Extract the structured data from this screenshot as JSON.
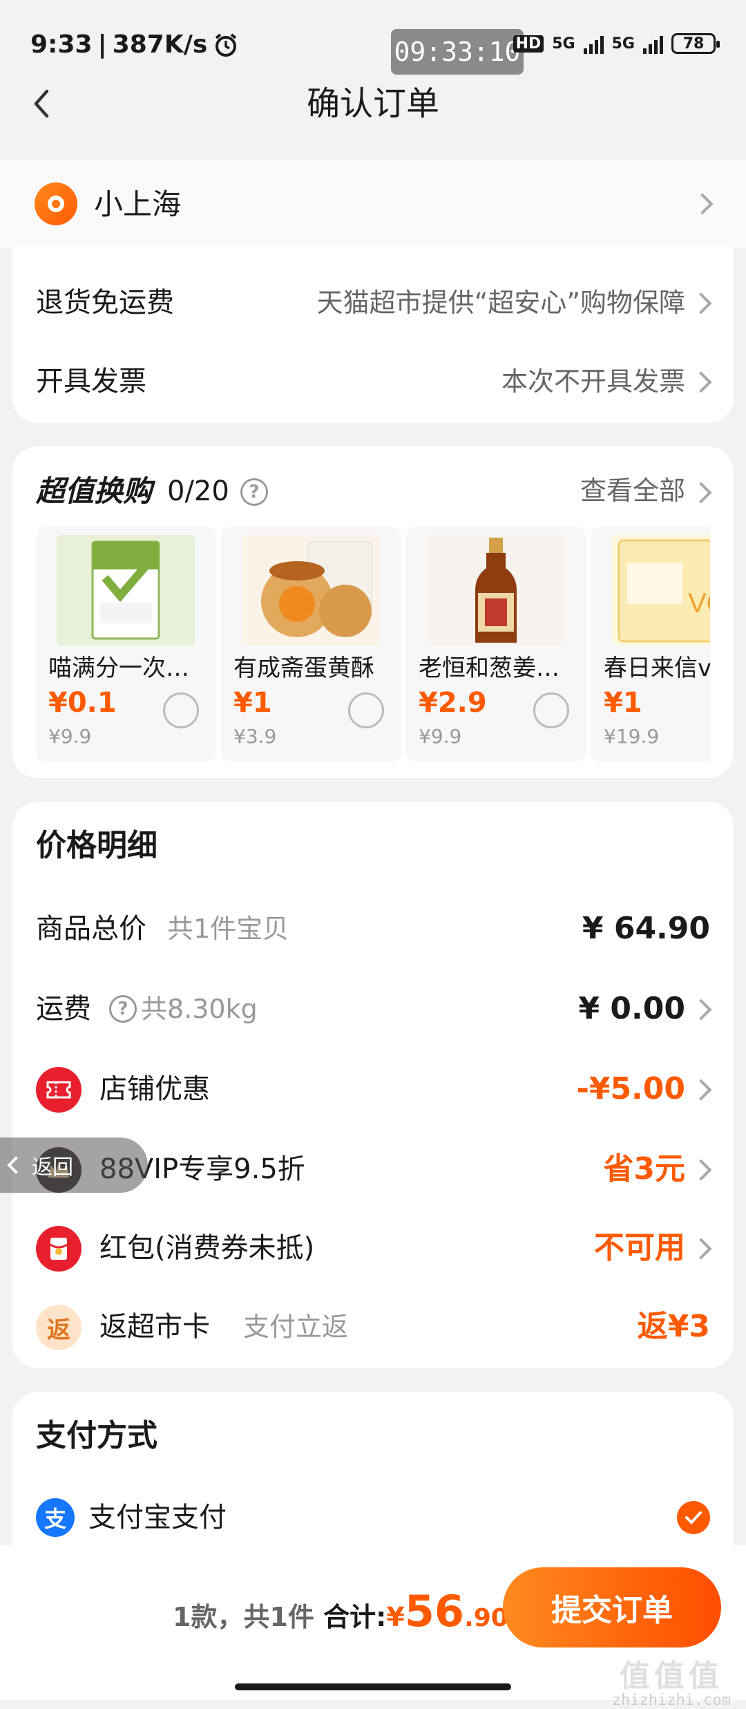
{
  "status_bar": {
    "time": "9:33",
    "speed": "387K/s",
    "clock_box": "09:33:10",
    "hd": "HD",
    "net1": "5G",
    "net2": "5G",
    "battery": "78"
  },
  "nav": {
    "title": "确认订单"
  },
  "address": {
    "name": "小上海"
  },
  "service": {
    "return_label": "退货免运费",
    "return_value": "天猫超市提供“超安心”购物保障",
    "invoice_label": "开具发票",
    "invoice_value": "本次不开具发票"
  },
  "deals": {
    "title": "超值换购",
    "count": "0/20",
    "view_all": "查看全部",
    "items": [
      {
        "name": "喵满分一次性保鲜袋",
        "price": "¥0.1",
        "original": "¥9.9",
        "img_color": "#dfe9c8",
        "img_label": "食品接触级PE"
      },
      {
        "name": "有成斋蛋黄酥",
        "price": "¥1",
        "original": "¥3.9",
        "img_color": "#f3d9b4",
        "img_label": "蛋黄酥"
      },
      {
        "name": "老恒和葱姜料酒",
        "price": "¥2.9",
        "original": "¥9.9",
        "img_color": "#c86b2a",
        "img_label": "料酒"
      },
      {
        "name": "春日来信vc",
        "price": "¥1",
        "original": "¥19.9",
        "img_color": "#fbe7a8",
        "img_label": "VC"
      }
    ]
  },
  "price": {
    "title": "价格明细",
    "goods_label": "商品总价",
    "goods_sub": "共1件宝贝",
    "goods_value": "¥ 64.90",
    "shipping_label": "运费",
    "shipping_sub": "共8.30kg",
    "shipping_value": "¥ 0.00",
    "shop_label": "店铺优惠",
    "shop_value": "-¥5.00",
    "vip_label": "88VIP专享9.5折",
    "vip_value": "省3元",
    "redpacket_label": "红包(消费券未抵)",
    "redpacket_value": "不可用",
    "cashback_label": "返超市卡",
    "cashback_sub": "支付立返",
    "cashback_value": "返¥3",
    "cashback_icon_char": "返"
  },
  "payment": {
    "title": "支付方式",
    "method": "支付宝支付",
    "icon_char": "支"
  },
  "back_pill": {
    "label": "返回"
  },
  "bottom": {
    "count_text": "1款，共1件",
    "total_label": "合计:",
    "yen": "¥",
    "total_int": "56",
    "total_dec": ".90",
    "submit": "提交订单"
  },
  "watermark": {
    "glyph": "值值值",
    "domain": "zhizhizhi.com"
  },
  "colors": {
    "accent": "#ff5a00",
    "background": "#f2f2f2"
  }
}
